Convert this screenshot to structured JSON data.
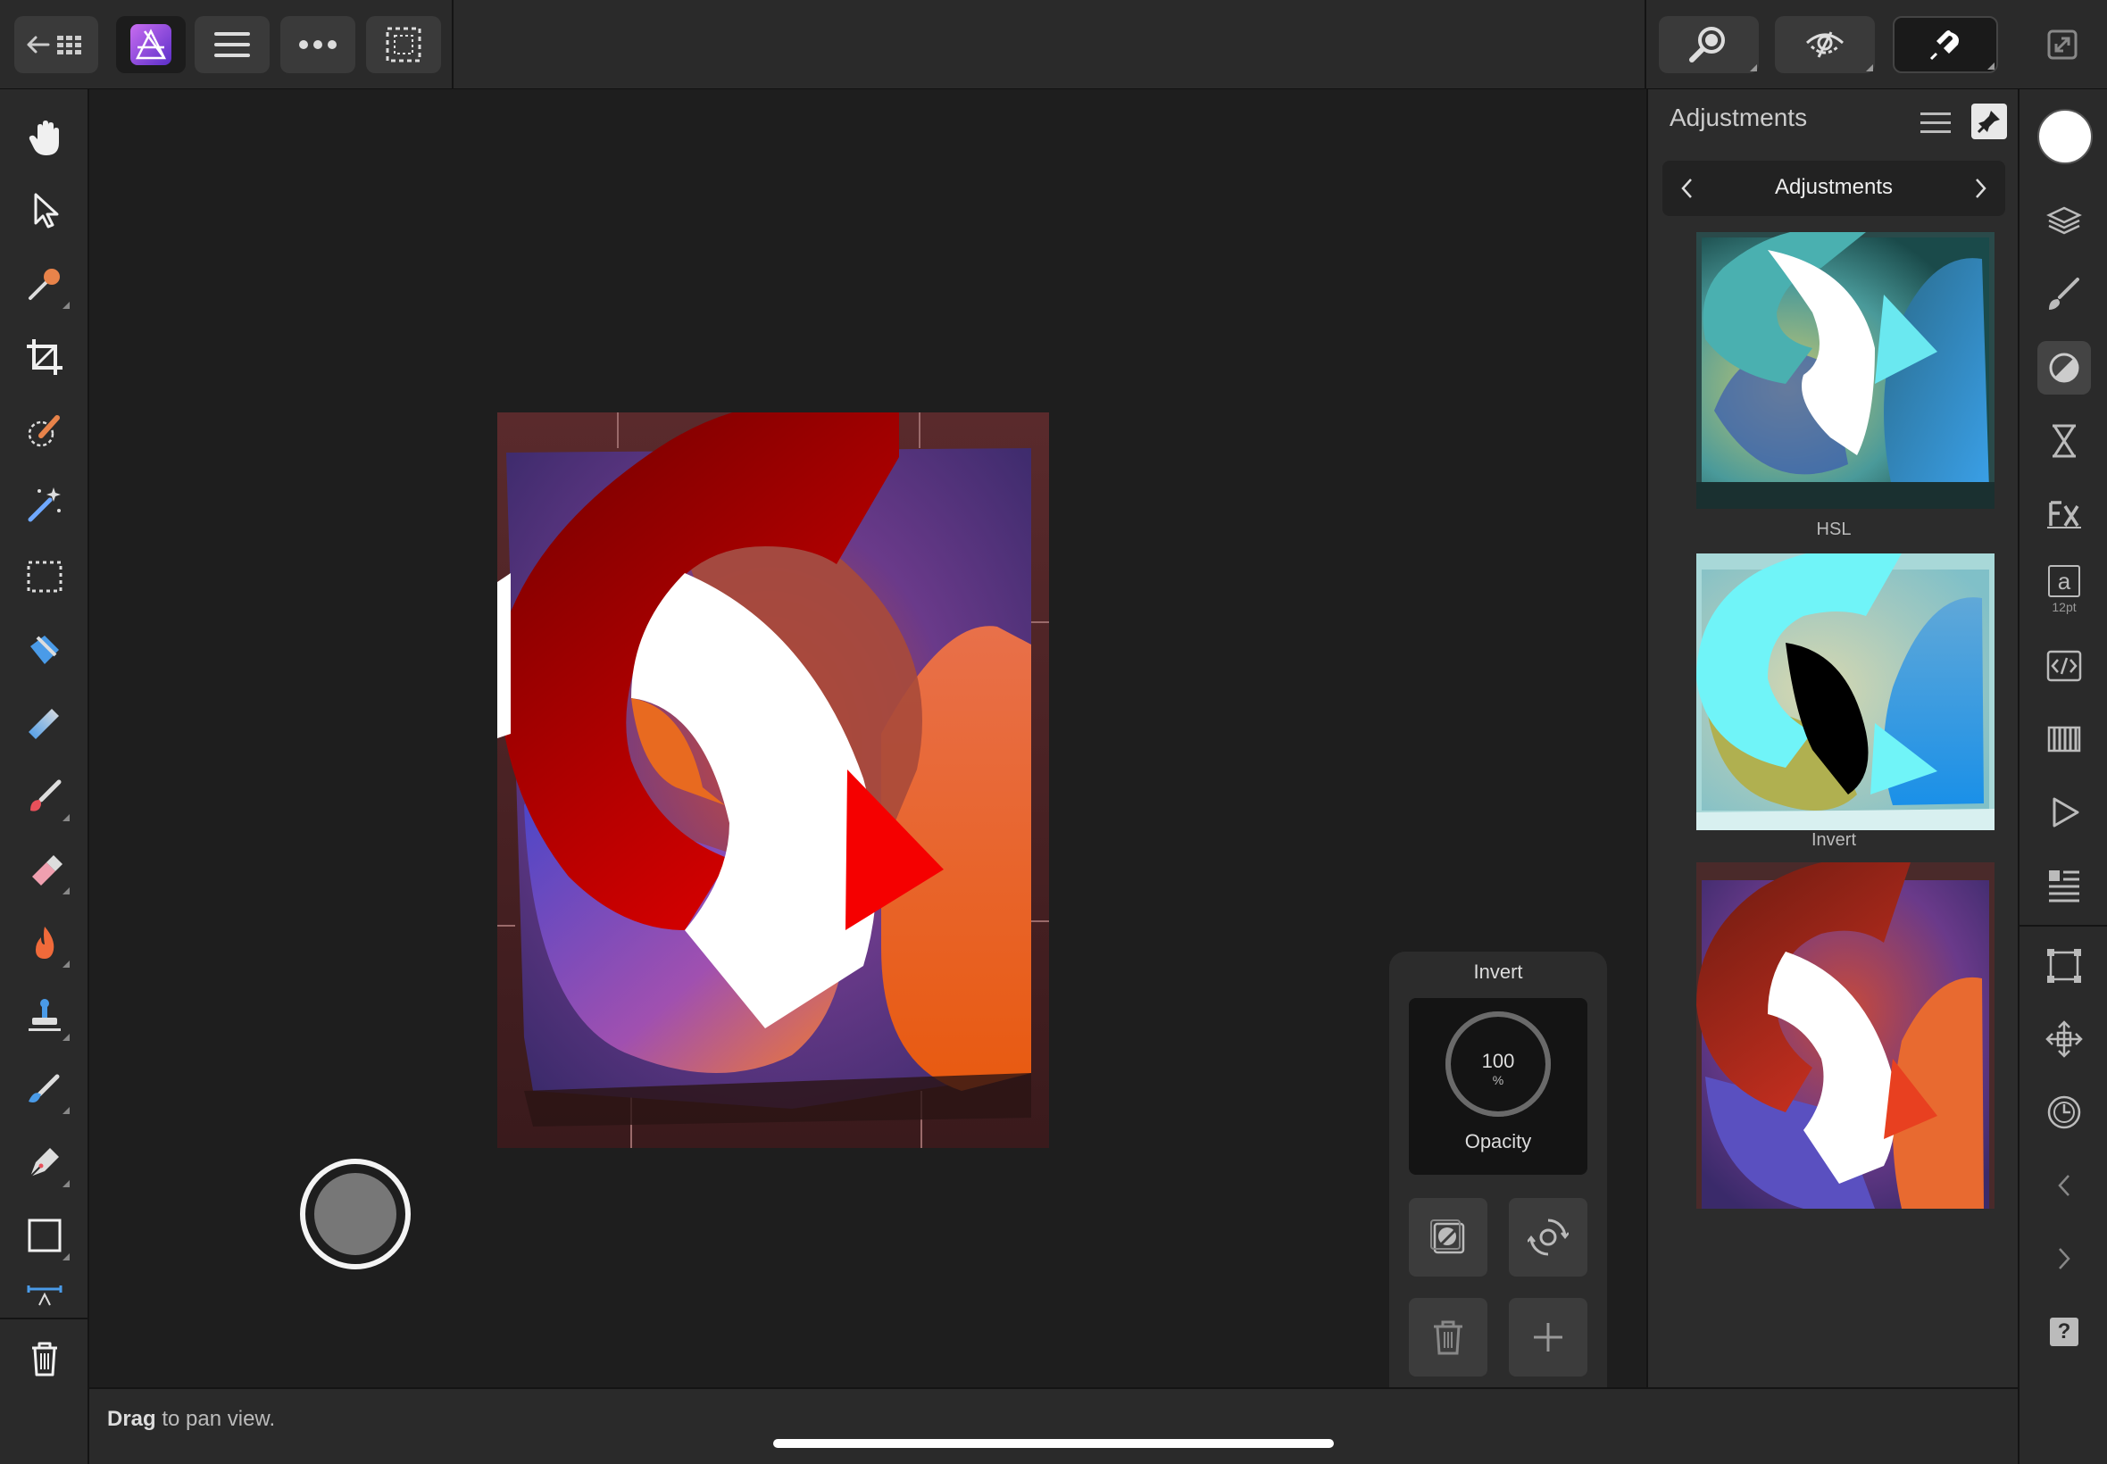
{
  "topbar": {
    "back_icon": "back-grid-icon",
    "app_icon": "affinity-photo-icon",
    "menu_icon": "hamburger-menu-icon",
    "more_icon": "more-ellipsis-icon",
    "selection_icon": "selection-marquee-icon",
    "right_tools": [
      "zoom-view-icon",
      "hide-view-icon",
      "snapping-icon"
    ],
    "fullscreen_icon": "fullscreen-icon"
  },
  "left_tools": [
    "view-hand-tool",
    "move-tool",
    "color-picker-tool",
    "crop-tool",
    "selection-brush-tool",
    "magic-wand-tool",
    "marquee-tool",
    "flood-fill-tool",
    "gradient-tool",
    "paint-brush-tool",
    "erase-brush-tool",
    "dodge-burn-tool",
    "clone-stamp-tool",
    "smudge-tool",
    "pen-tool",
    "rectangle-tool",
    "text-frame-tool"
  ],
  "panel": {
    "title": "Adjustments",
    "nav_label": "Adjustments",
    "presets": [
      {
        "label": "HSL"
      },
      {
        "label": "Invert"
      },
      {
        "label": ""
      }
    ]
  },
  "context": {
    "title": "Invert",
    "opacity_value": "100",
    "opacity_unit": "%",
    "opacity_label": "Opacity",
    "opacity_fraction": 1.0
  },
  "status": {
    "bold": "Drag",
    "rest": " to pan view."
  },
  "right_tools": [
    "color-swatch",
    "layers-icon",
    "brushes-icon",
    "adjustments-icon",
    "history-hourglass-icon",
    "fx-icon",
    "character-icon",
    "export-code-icon",
    "channels-icon",
    "macros-play-icon",
    "stock-icon",
    "transform-icon",
    "navigator-move-icon",
    "timeline-icon",
    "prev-icon",
    "next-icon",
    "help-icon"
  ],
  "right_text": {
    "char_a": "a",
    "char_size": "12pt",
    "help": "?"
  },
  "colors": {
    "accent": "#8a4fe0",
    "bg": "#1e1e1e",
    "bar": "#2a2a2a"
  }
}
